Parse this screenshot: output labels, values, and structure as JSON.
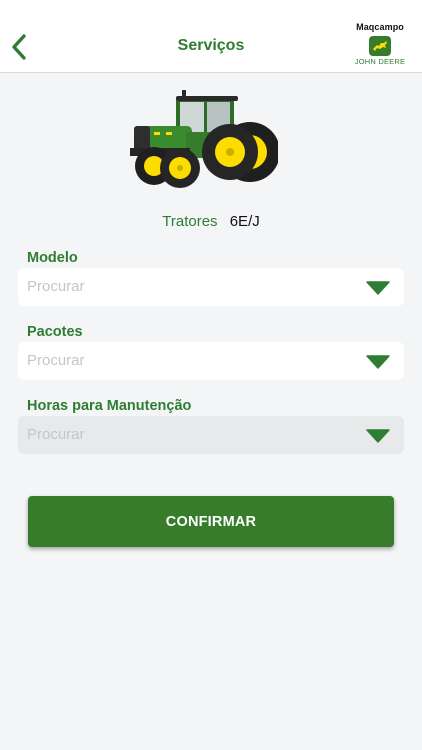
{
  "header": {
    "title": "Serviços",
    "back_icon": "chevron-left-icon",
    "brand": {
      "name": "Maqcampo",
      "logo_icon": "john-deere-deer-icon",
      "sub": "JOHN DEERE"
    }
  },
  "product": {
    "image": "green-tractor-image",
    "category": "Tratores",
    "model": "6E/J"
  },
  "form": {
    "modelo": {
      "label": "Modelo",
      "placeholder": "Procurar",
      "enabled": true
    },
    "pacotes": {
      "label": "Pacotes",
      "placeholder": "Procurar",
      "enabled": true
    },
    "horas": {
      "label": "Horas para Manutenção",
      "placeholder": "Procurar",
      "enabled": false
    }
  },
  "actions": {
    "confirm_label": "CONFIRMAR"
  },
  "colors": {
    "brand_green": "#367c2b",
    "text_green": "#2f7d32",
    "accent_yellow": "#fddc00",
    "background": "#f4f5f7",
    "placeholder": "#c4c6c9"
  }
}
